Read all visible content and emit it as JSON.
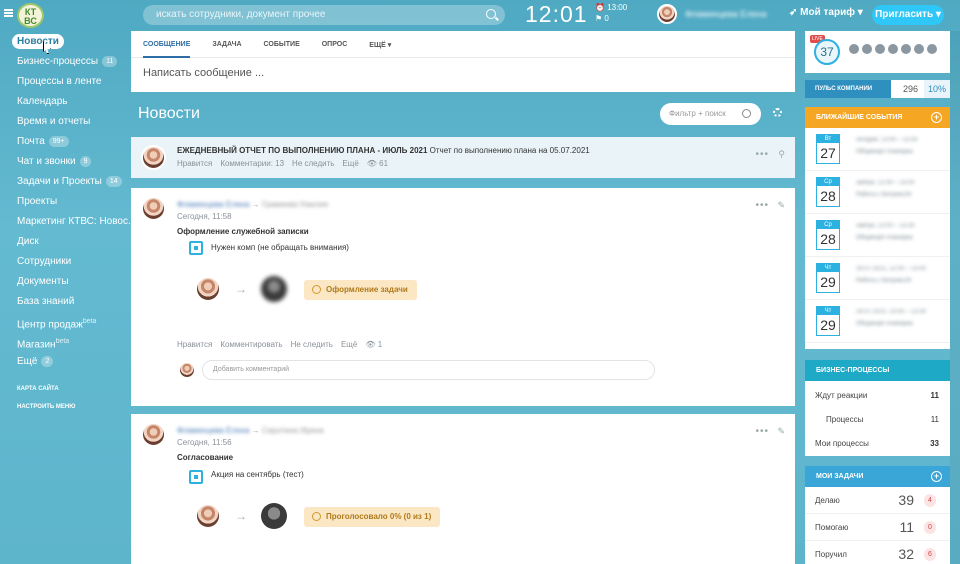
{
  "header": {
    "logo": "КТ ВС",
    "search_placeholder": "искать сотрудники, документ прочее",
    "time": "12:01",
    "alarm_time": "13:00",
    "flag_count": "0",
    "user_name": "Фламинцева Елена",
    "tariff_label": "Мой тариф",
    "invite_label": "Пригласить"
  },
  "sidebar": {
    "items": [
      {
        "label": "Новости",
        "count": ""
      },
      {
        "label": "Бизнес-процессы",
        "count": "11"
      },
      {
        "label": "Процессы в ленте",
        "count": ""
      },
      {
        "label": "Календарь",
        "count": ""
      },
      {
        "label": "Время и отчеты",
        "count": ""
      },
      {
        "label": "Почта",
        "count": "99+"
      },
      {
        "label": "Чат и звонки",
        "count": "9"
      },
      {
        "label": "Задачи и Проекты",
        "count": "14"
      },
      {
        "label": "Проекты",
        "count": ""
      },
      {
        "label": "Маркетинг КТВС: Новос...",
        "count": ""
      },
      {
        "label": "Диск",
        "count": ""
      },
      {
        "label": "Сотрудники",
        "count": ""
      },
      {
        "label": "Документы",
        "count": ""
      },
      {
        "label": "База знаний",
        "count": ""
      },
      {
        "label": "Центр продаж",
        "count": "",
        "sup": "beta"
      },
      {
        "label": "Магазин",
        "count": "",
        "sup": "beta"
      },
      {
        "label": "Ещё",
        "count": "2"
      }
    ],
    "sitemap": "КАРТА САЙТА",
    "settings": "НАСТРОИТЬ МЕНЮ"
  },
  "composer": {
    "tabs": [
      "СООБЩЕНИЕ",
      "ЗАДАЧА",
      "СОБЫТИЕ",
      "ОПРОС",
      "ЕЩЁ"
    ],
    "placeholder": "Написать сообщение ..."
  },
  "feed": {
    "title": "Новости",
    "filter_placeholder": "Фильтр + поиск",
    "pinned": {
      "title": "ЕЖЕДНЕВНЫЙ ОТЧЕТ ПО ВЫПОЛНЕНИЮ ПЛАНА - ИЮЛЬ 2021",
      "subtitle": "Отчет по выполнению плана на 05.07.2021",
      "like": "Нравится",
      "comments": "Комментарии: 13",
      "unfollow": "Не следить",
      "more": "Ещё",
      "views": "61"
    },
    "posts": [
      {
        "author": "Фламинцева Елена",
        "target": "Грамиева Наилия",
        "time": "Сегодня, 11:58",
        "title": "Оформление служебной записки",
        "task": "Нужен комп (не обращать внимания)",
        "status": "Оформление задачи",
        "like": "Нравится",
        "comment": "Комментировать",
        "unfollow": "Не следить",
        "more": "Ещё",
        "views": "1",
        "comment_placeholder": "Добавить комментарий"
      },
      {
        "author": "Фламинцева Елена",
        "target": "Сиротина Ирина",
        "time": "Сегодня, 11:56",
        "title": "Согласование",
        "task": "Акция на сентябрь (тест)",
        "status": "Проголосовало 0% (0 из 1)"
      }
    ]
  },
  "right": {
    "pulse_count": "37",
    "live": "LIVE",
    "pulse_label": "ПУЛЬС КОМПАНИИ",
    "pulse_value": "296",
    "pulse_pct": "10%",
    "events_title": "БЛИЖАЙШИЕ СОБЫТИЯ",
    "events": [
      {
        "dow": "Вт",
        "day": "27",
        "l1": "сегодня, 13:00 – 13:30",
        "l2": "Общекорп планерка"
      },
      {
        "dow": "Ср",
        "day": "28",
        "l1": "завтра, 12:00 – 13:00",
        "l2": "Работа с Битрикс24"
      },
      {
        "dow": "Ср",
        "day": "28",
        "l1": "завтра, 13:00 – 13:30",
        "l2": "Общекорп планерка"
      },
      {
        "dow": "Чт",
        "day": "29",
        "l1": "29.07.2021, 12:00 – 13:00",
        "l2": "Работа с Битрикс24"
      },
      {
        "dow": "Чт",
        "day": "29",
        "l1": "29.07.2021, 13:00 – 13:30",
        "l2": "Общекорп планерка"
      }
    ],
    "bp_title": "БИЗНЕС-ПРОЦЕССЫ",
    "bp_rows": [
      {
        "label": "Ждут реакции",
        "value": "11"
      },
      {
        "label": "Процессы",
        "value": "11"
      },
      {
        "label": "Мои процессы",
        "value": "33"
      }
    ],
    "tasks_title": "МОИ ЗАДАЧИ",
    "task_rows": [
      {
        "label": "Делаю",
        "value": "39",
        "red": "4"
      },
      {
        "label": "Помогаю",
        "value": "11",
        "red": "0"
      },
      {
        "label": "Поручил",
        "value": "32",
        "red": "6"
      }
    ]
  },
  "colors": {
    "accent": "#2cb1e0",
    "events_header": "#f5a623",
    "bp_header": "#1ea9c7",
    "tasks_header": "#3aa6d8"
  }
}
